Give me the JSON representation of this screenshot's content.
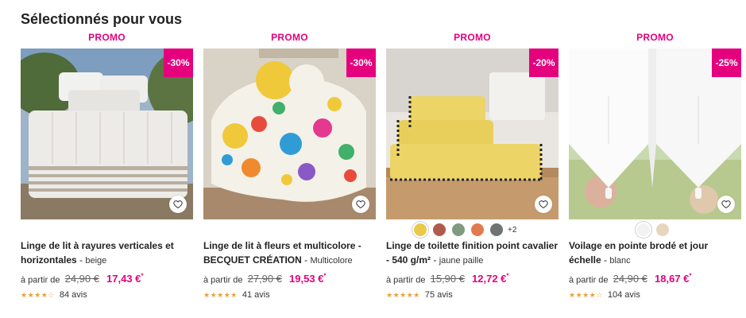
{
  "section": {
    "title": "Sélectionnés pour vous"
  },
  "colors": {
    "accent": "#e5007d",
    "star": "#e8a13a"
  },
  "products": [
    {
      "promo": "PROMO",
      "discount": "-30%",
      "name": "Linge de lit à rayures verticales et horizontales",
      "variant": "beige",
      "price_prefix": "à partir de",
      "old_price": "24,90 €",
      "new_price": "17,43 €",
      "asterisk": "*",
      "stars": "★★★★☆",
      "reviews": "84 avis",
      "image_icon": "striped-bedding-image",
      "favorite_icon": "heart-icon"
    },
    {
      "promo": "PROMO",
      "discount": "-30%",
      "name": "Linge de lit à fleurs et multicolore - BECQUET CRÉATION",
      "variant": "Multicolore",
      "price_prefix": "à partir de",
      "old_price": "27,90 €",
      "new_price": "19,53 €",
      "asterisk": "*",
      "stars": "★★★★★",
      "reviews": "41 avis",
      "image_icon": "floral-bedding-image",
      "favorite_icon": "heart-icon"
    },
    {
      "promo": "PROMO",
      "discount": "-20%",
      "name": "Linge de toilette finition point cavalier - 540 g/m²",
      "variant": "jaune paille",
      "price_prefix": "à partir de",
      "old_price": "15,90 €",
      "new_price": "12,72 €",
      "asterisk": "*",
      "stars": "★★★★★",
      "reviews": "75 avis",
      "image_icon": "yellow-towels-image",
      "favorite_icon": "heart-icon",
      "swatches": [
        "#e8c94a",
        "#b05a4e",
        "#7f9a7f",
        "#e27a4f",
        "#6f7473"
      ],
      "more_colors": "+2"
    },
    {
      "promo": "PROMO",
      "discount": "-25%",
      "name": "Voilage en pointe brodé et jour échelle",
      "variant": "blanc",
      "price_prefix": "à partir de",
      "old_price": "24,90 €",
      "new_price": "18,67 €",
      "asterisk": "*",
      "stars": "★★★★☆",
      "reviews": "104 avis",
      "image_icon": "white-curtain-image",
      "favorite_icon": "heart-icon",
      "swatches": [
        "#f2f2f2",
        "#e6d6bd"
      ]
    }
  ]
}
